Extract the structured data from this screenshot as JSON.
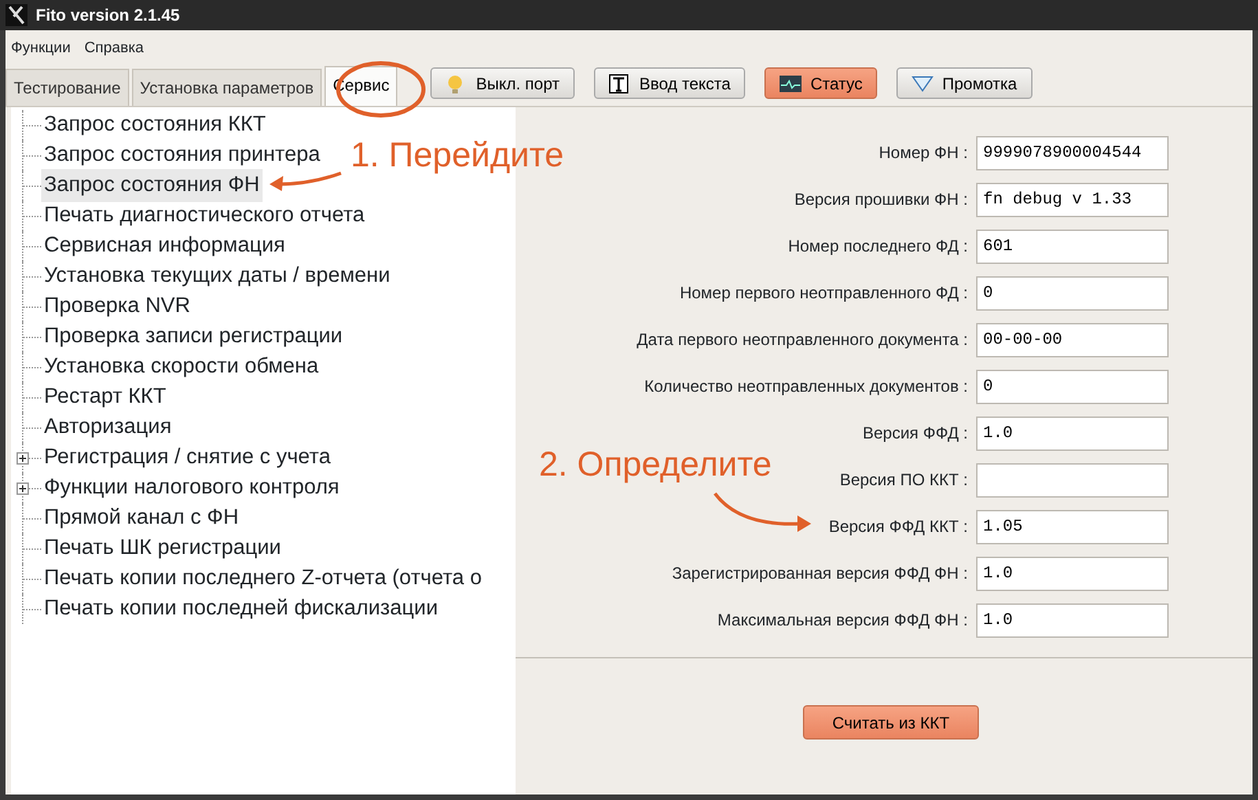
{
  "window": {
    "title": "Fito version 2.1.45"
  },
  "menu": [
    "Функции",
    "Справка"
  ],
  "tabs": [
    {
      "label": "Тестирование",
      "selected": false
    },
    {
      "label": "Установка параметров",
      "selected": false
    },
    {
      "label": "Сервис",
      "selected": true
    }
  ],
  "toolbar": [
    {
      "label": "Выкл. порт",
      "kind": "bulb",
      "selected": false
    },
    {
      "label": "Ввод текста",
      "kind": "text",
      "selected": false
    },
    {
      "label": "Статус",
      "kind": "monitor",
      "selected": true
    },
    {
      "label": "Промотка",
      "kind": "feed",
      "selected": false
    }
  ],
  "tree": [
    {
      "label": "Запрос состояния ККТ",
      "kind": "leaf",
      "selected": false
    },
    {
      "label": "Запрос состояния принтера",
      "kind": "leaf",
      "selected": false
    },
    {
      "label": "Запрос состояния ФН",
      "kind": "leaf",
      "selected": true
    },
    {
      "label": "Печать диагностического отчета",
      "kind": "leaf",
      "selected": false
    },
    {
      "label": "Сервисная информация",
      "kind": "leaf",
      "selected": false
    },
    {
      "label": "Установка текущих даты / времени",
      "kind": "leaf",
      "selected": false
    },
    {
      "label": "Проверка NVR",
      "kind": "leaf",
      "selected": false
    },
    {
      "label": "Проверка записи регистрации",
      "kind": "leaf",
      "selected": false
    },
    {
      "label": "Установка скорости обмена",
      "kind": "leaf",
      "selected": false
    },
    {
      "label": "Рестарт ККТ",
      "kind": "leaf",
      "selected": false
    },
    {
      "label": "Авторизация",
      "kind": "leaf",
      "selected": false
    },
    {
      "label": "Регистрация / снятие с учета",
      "kind": "folder",
      "expanded": false,
      "selected": false
    },
    {
      "label": "Функции налогового контроля",
      "kind": "folder",
      "expanded": false,
      "selected": false
    },
    {
      "label": "Прямой канал с ФН",
      "kind": "leaf",
      "selected": false
    },
    {
      "label": "Печать ШК регистрации",
      "kind": "leaf",
      "selected": false
    },
    {
      "label": "Печать копии последнего Z-отчета (отчета о",
      "kind": "leaf",
      "selected": false
    },
    {
      "label": "Печать копии последней фискализации",
      "kind": "leaf",
      "selected": false
    }
  ],
  "fields": [
    {
      "label": "Номер ФН :",
      "value": "9999078900004544"
    },
    {
      "label": "Версия прошивки ФН :",
      "value": "fn debug v 1.33"
    },
    {
      "label": "Номер последнего ФД :",
      "value": "601"
    },
    {
      "label": "Номер первого неотправленного ФД :",
      "value": "0"
    },
    {
      "label": "Дата первого неотправленного документа :",
      "value": "00-00-00"
    },
    {
      "label": "Количество неотправленных документов :",
      "value": "0"
    },
    {
      "label": "Версия ФФД :",
      "value": "1.0"
    },
    {
      "label": "Версия ПО ККТ :"
    },
    {
      "label": "Версия ФФД ККТ :",
      "value": "1.05"
    },
    {
      "label": "Зарегистрированная версия ФФД ФН :",
      "value": "1.0"
    },
    {
      "label": "Максимальная версия ФФД ФН :",
      "value": "1.0"
    }
  ],
  "read_button": {
    "label": "Считать из ККТ"
  },
  "annotations": [
    {
      "text": "1. Перейдите"
    },
    {
      "text": "2. Определите"
    }
  ]
}
